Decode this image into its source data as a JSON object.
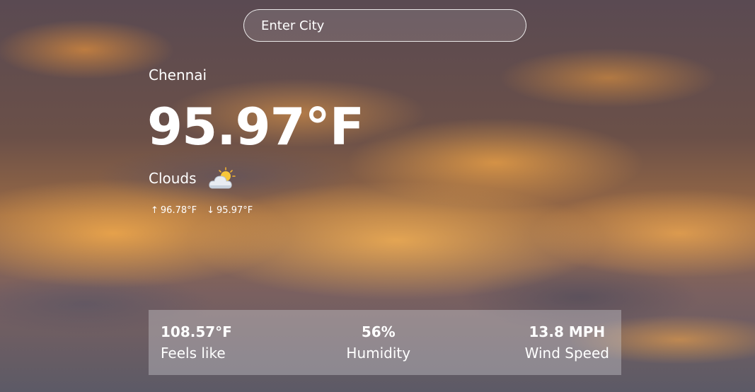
{
  "search": {
    "placeholder": "Enter City"
  },
  "weather": {
    "city": "Chennai",
    "temperature": "95.97°F",
    "condition": "Clouds",
    "condition_icon": "sun-behind-cloud-icon",
    "high_arrow": "↑",
    "high": "96.78°F",
    "low_arrow": "↓",
    "low": "95.97°F"
  },
  "stats": {
    "feels_like": {
      "value": "108.57°F",
      "label": "Feels like"
    },
    "humidity": {
      "value": "56%",
      "label": "Humidity"
    },
    "wind": {
      "value": "13.8 MPH",
      "label": "Wind Speed"
    }
  }
}
